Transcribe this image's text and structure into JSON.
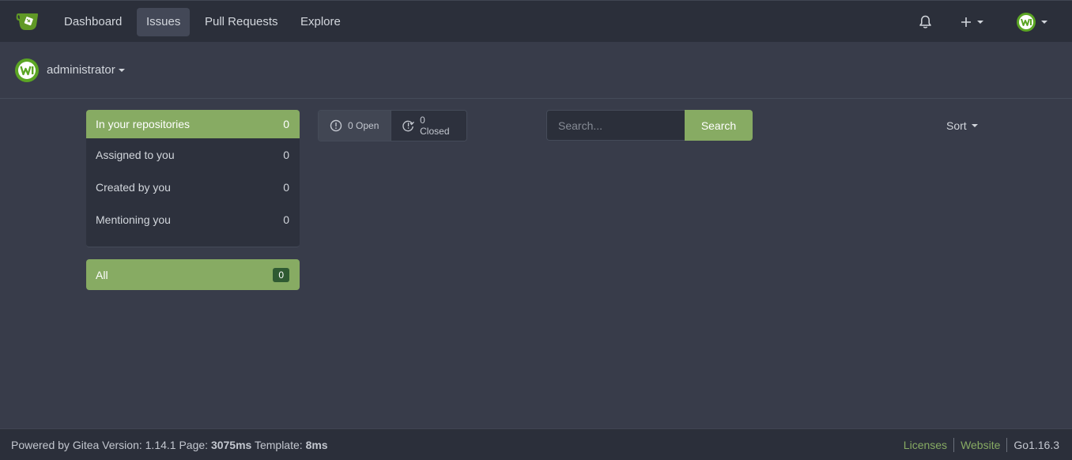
{
  "nav": {
    "items": [
      {
        "label": "Dashboard",
        "active": false
      },
      {
        "label": "Issues",
        "active": true
      },
      {
        "label": "Pull Requests",
        "active": false
      },
      {
        "label": "Explore",
        "active": false
      }
    ]
  },
  "user": {
    "name": "administrator"
  },
  "filters": {
    "items": [
      {
        "label": "In your repositories",
        "count": "0",
        "active": true
      },
      {
        "label": "Assigned to you",
        "count": "0",
        "active": false
      },
      {
        "label": "Created by you",
        "count": "0",
        "active": false
      },
      {
        "label": "Mentioning you",
        "count": "0",
        "active": false
      }
    ],
    "all": {
      "label": "All",
      "count": "0"
    }
  },
  "state": {
    "open_label": "0 Open",
    "closed_label": "0 Closed"
  },
  "search": {
    "placeholder": "Search...",
    "button_label": "Search"
  },
  "sort": {
    "label": "Sort"
  },
  "footer": {
    "powered_prefix": "Powered by Gitea Version: 1.14.1 Page: ",
    "page_time": "3075ms",
    "template_prefix": " Template: ",
    "template_time": "8ms",
    "links": [
      "Licenses",
      "Website"
    ],
    "go_version": "Go1.16.3"
  },
  "colors": {
    "accent": "#87ab63",
    "background": "#383c4a",
    "navbar": "#2b2f3a"
  }
}
